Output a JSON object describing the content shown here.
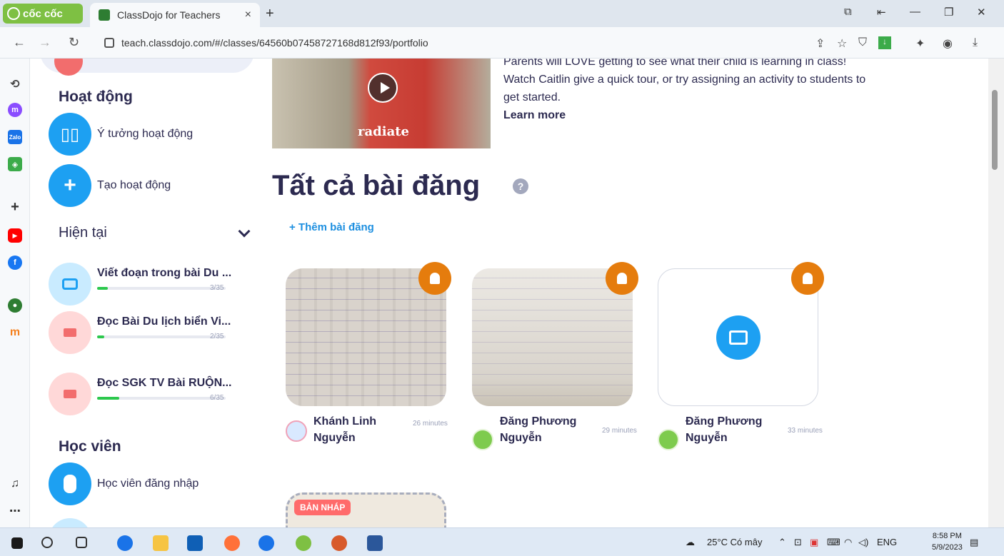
{
  "browser": {
    "brand": "cốc cốc",
    "tab_title": "ClassDojo for Teachers",
    "tab_close": "×",
    "new_tab": "+",
    "url": "teach.classdojo.com/#/classes/64560b07458727168d812f93/portfolio"
  },
  "sidebar": {
    "activities_title": "Hoạt động",
    "ideas_label": "Ý tưởng hoạt động",
    "create_label": "Tạo hoạt động",
    "current_title": "Hiện tại",
    "activities": [
      {
        "title": "Viết đoạn trong bài Du ...",
        "count": "3/35",
        "progress": 0.086
      },
      {
        "title": "Đọc Bài Du lịch biển Vi...",
        "count": "2/35",
        "progress": 0.057
      },
      {
        "title": "Đọc SGK TV Bài RUỘN...",
        "count": "6/35",
        "progress": 0.171
      }
    ],
    "students_title": "Học viên",
    "student_login_label": "Học viên đăng nhập"
  },
  "main": {
    "video_shirt_text": "radiate",
    "description": "Parents will LOVE getting to see what their child is learning in class! Watch Caitlin give a quick tour, or try assigning an activity to students to get started.",
    "learn_more": "Learn more",
    "heading": "Tất cả bài đăng",
    "help_icon": "?",
    "add_post": "+ Thêm bài đăng",
    "posts": [
      {
        "author": "Khánh Linh Nguyễn",
        "time": "26 minutes"
      },
      {
        "author": "Đăng Phương Nguyễn",
        "time": "29 minutes"
      },
      {
        "author": "Đăng Phương Nguyễn",
        "time": "33 minutes"
      }
    ],
    "draft_tag": "BẢN NHÁP"
  },
  "taskbar": {
    "weather": "25°C Có mây",
    "lang": "ENG",
    "time": "8:58 PM",
    "date": "5/9/2023"
  },
  "colors": {
    "brand_green": "#7ec043",
    "dojo_blue": "#1da0f2",
    "bell_orange": "#e57c0d",
    "progress_green": "#2cc84d",
    "text_dark": "#2c2a50"
  }
}
